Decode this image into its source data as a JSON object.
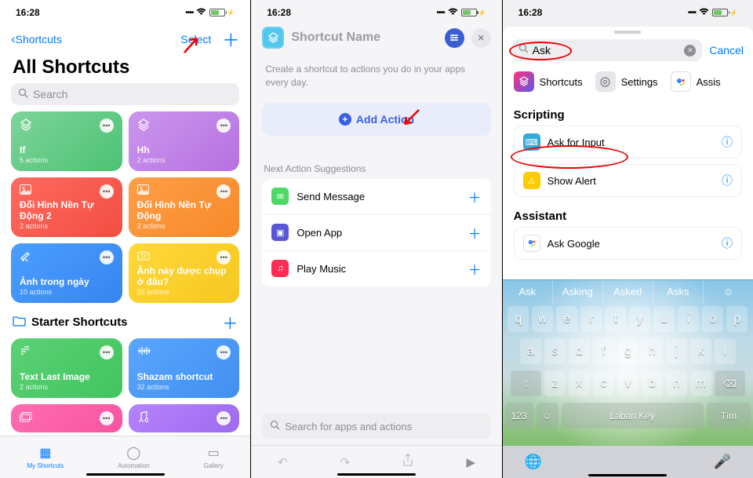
{
  "status": {
    "time": "16:28",
    "cellular_icon": "●●●●",
    "wifi_icon": "wifi",
    "charging": true
  },
  "screen1": {
    "back_label": "Shortcuts",
    "select_label": "Select",
    "title": "All Shortcuts",
    "search_placeholder": "Search",
    "shortcuts": [
      {
        "title": "If",
        "sub": "5 actions",
        "color": "green",
        "icon": "layers"
      },
      {
        "title": "Hh",
        "sub": "2 actions",
        "color": "purple",
        "icon": "layers"
      },
      {
        "title": "Đổi Hình Nền Tự Động 2",
        "sub": "2 actions",
        "color": "red",
        "icon": "image"
      },
      {
        "title": "Đổi Hình Nền Tự Động",
        "sub": "2 actions",
        "color": "orange",
        "icon": "image"
      },
      {
        "title": "Ảnh trong ngày",
        "sub": "10 actions",
        "color": "blue",
        "icon": "telescope"
      },
      {
        "title": "Ảnh này được chụp ở đâu?",
        "sub": "15 actions",
        "color": "yellow",
        "icon": "camera"
      }
    ],
    "folder": {
      "title": "Starter Shortcuts"
    },
    "starters": [
      {
        "title": "Text Last Image",
        "sub": "2 actions",
        "color": "green2",
        "icon": "text"
      },
      {
        "title": "Shazam shortcut",
        "sub": "32 actions",
        "color": "blue2",
        "icon": "wave"
      }
    ],
    "extra": [
      {
        "color": "pink",
        "icon": "gallery"
      },
      {
        "color": "purple2",
        "icon": "music"
      }
    ],
    "tabs": [
      {
        "label": "My Shortcuts",
        "active": true
      },
      {
        "label": "Automation",
        "active": false
      },
      {
        "label": "Gallery",
        "active": false
      }
    ]
  },
  "screen2": {
    "name_placeholder": "Shortcut Name",
    "instruction": "Create a shortcut to actions you do in your apps every day.",
    "add_action": "Add Action",
    "suggestions_label": "Next Action Suggestions",
    "suggestions": [
      {
        "label": "Send Message",
        "color": "#4cd964"
      },
      {
        "label": "Open App",
        "color": "#5856d6"
      },
      {
        "label": "Play Music",
        "color": "#ff2d55"
      }
    ],
    "search_placeholder": "Search for apps and actions"
  },
  "screen3": {
    "search_value": "Ask",
    "cancel": "Cancel",
    "apps": [
      {
        "name": "Shortcuts"
      },
      {
        "name": "Settings"
      },
      {
        "name": "Assis"
      }
    ],
    "sections": [
      {
        "title": "Scripting",
        "rows": [
          {
            "label": "Ask for Input",
            "color": "#34aadc",
            "highlighted": true
          },
          {
            "label": "Show Alert",
            "color": "#ffcc00"
          }
        ]
      },
      {
        "title": "Assistant",
        "rows": [
          {
            "label": "Ask Google",
            "color": "#fff"
          }
        ]
      }
    ],
    "keyboard": {
      "suggestions": [
        "Ask",
        "Asking",
        "Asked",
        "Asks",
        "☺"
      ],
      "row1": [
        "q",
        "w",
        "e",
        "r",
        "t",
        "y",
        "u",
        "i",
        "o",
        "p"
      ],
      "row2": [
        "a",
        "s",
        "d",
        "f",
        "g",
        "h",
        "j",
        "k",
        "l"
      ],
      "row3_shift": "⇧",
      "row3": [
        "z",
        "x",
        "c",
        "v",
        "b",
        "n",
        "m"
      ],
      "row3_del": "⌫",
      "num": "123",
      "space": "Laban Key",
      "enter": "Tìm"
    }
  }
}
